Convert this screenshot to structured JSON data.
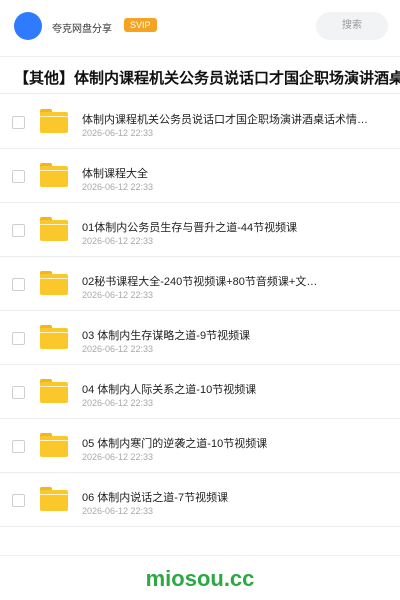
{
  "header": {
    "username": "夸克网盘分享",
    "badge": "SVIP",
    "search_placeholder": "搜索"
  },
  "share": {
    "title": "【其他】体制内课程机关公务员说话口才国企职场演讲酒桌"
  },
  "files": [
    {
      "name": "体制内课程机关公务员说话口才国企职场演讲酒桌话术情…",
      "date": "2026-06-12 22:33"
    },
    {
      "name": "体制课程大全",
      "date": "2026-06-12 22:33"
    },
    {
      "name": "01体制内公务员生存与晋升之道-44节视频课",
      "date": "2026-06-12 22:33"
    },
    {
      "name": "02秘书课程大全-240节视频课+80节音频课+文…",
      "date": "2026-06-12 22:33"
    },
    {
      "name": "03 体制内生存谋略之道-9节视频课",
      "date": "2026-06-12 22:33"
    },
    {
      "name": "04 体制内人际关系之道-10节视频课",
      "date": "2026-06-12 22:33"
    },
    {
      "name": "05 体制内寒门的逆袭之道-10节视频课",
      "date": "2026-06-12 22:33"
    },
    {
      "name": "06 体制内说话之道-7节视频课",
      "date": "2026-06-12 22:33"
    }
  ],
  "footer": {
    "brand": "miosou.cc",
    "brand_color": "#2ea844"
  },
  "colors": {
    "avatar": "#2f7bff",
    "badge": "#f6a323",
    "folder": "#fbc82b"
  },
  "icons": {
    "avatar": "avatar-circle",
    "folder": "folder-icon",
    "checkbox": "checkbox-icon"
  }
}
